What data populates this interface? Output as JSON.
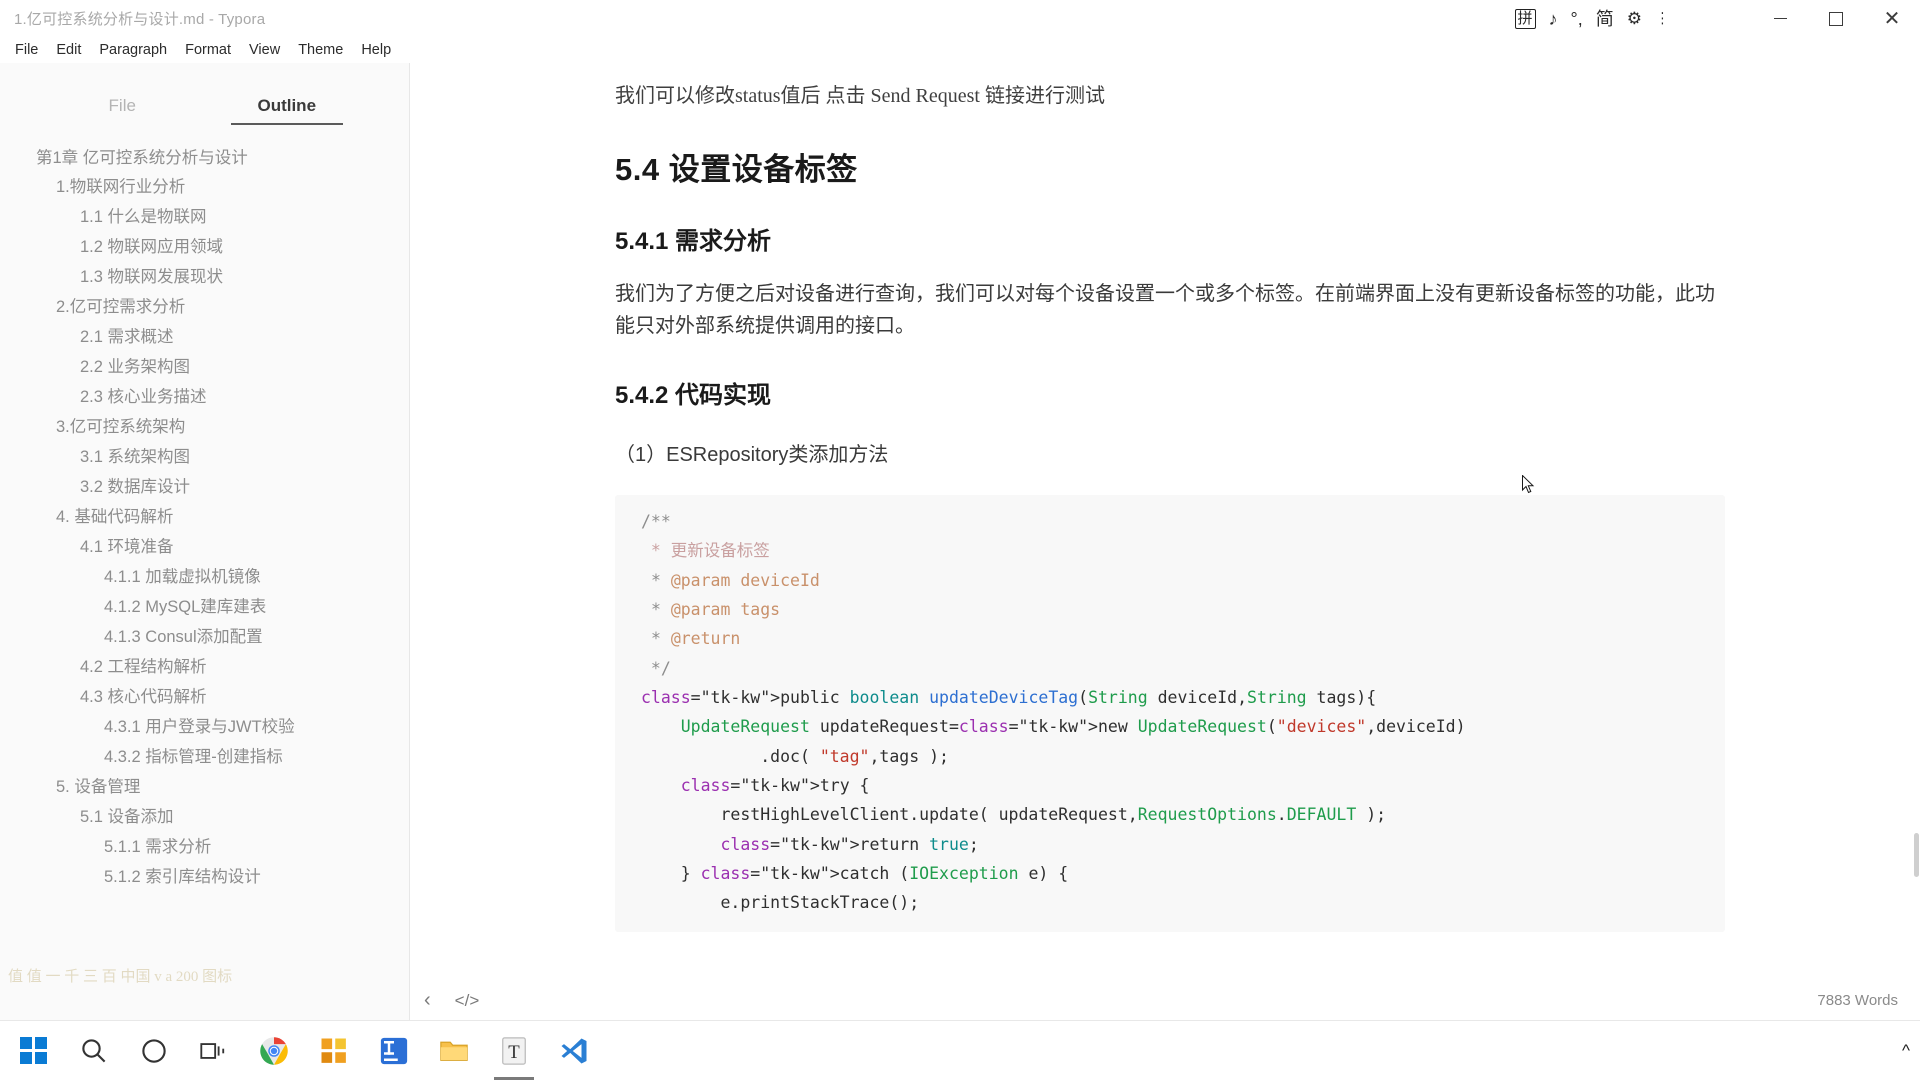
{
  "window": {
    "title": "1.亿可控系统分析与设计.md - Typora",
    "minimize_label": "Minimize",
    "maximize_label": "Maximize",
    "close_label": "Close"
  },
  "tray": {
    "ime_label": "拼",
    "music_icon": "♪",
    "keyboard_icon": "°,",
    "mode_label": "简",
    "gear_icon": "⚙",
    "more_icon": "⋮"
  },
  "menubar": {
    "items": [
      {
        "label": "File",
        "name": "menu-file"
      },
      {
        "label": "Edit",
        "name": "menu-edit"
      },
      {
        "label": "Paragraph",
        "name": "menu-paragraph"
      },
      {
        "label": "Format",
        "name": "menu-format"
      },
      {
        "label": "View",
        "name": "menu-view"
      },
      {
        "label": "Theme",
        "name": "menu-theme"
      },
      {
        "label": "Help",
        "name": "menu-help"
      }
    ]
  },
  "sidebar": {
    "tabs": [
      {
        "label": "File",
        "active": false
      },
      {
        "label": "Outline",
        "active": true
      }
    ],
    "outline": [
      {
        "label": "第1章 亿可控系统分析与设计",
        "level": 1
      },
      {
        "label": "1.物联网行业分析",
        "level": 2
      },
      {
        "label": "1.1 什么是物联网",
        "level": 3
      },
      {
        "label": "1.2 物联网应用领域",
        "level": 3
      },
      {
        "label": "1.3 物联网发展现状",
        "level": 3
      },
      {
        "label": "2.亿可控需求分析",
        "level": 2
      },
      {
        "label": "2.1 需求概述",
        "level": 3
      },
      {
        "label": "2.2 业务架构图",
        "level": 3
      },
      {
        "label": "2.3 核心业务描述",
        "level": 3
      },
      {
        "label": "3.亿可控系统架构",
        "level": 2
      },
      {
        "label": "3.1 系统架构图",
        "level": 3
      },
      {
        "label": "3.2 数据库设计",
        "level": 3
      },
      {
        "label": "4. 基础代码解析",
        "level": 2
      },
      {
        "label": "4.1 环境准备",
        "level": 3
      },
      {
        "label": "4.1.1 加载虚拟机镜像",
        "level": 4
      },
      {
        "label": "4.1.2 MySQL建库建表",
        "level": 4
      },
      {
        "label": "4.1.3 Consul添加配置",
        "level": 4
      },
      {
        "label": "4.2 工程结构解析",
        "level": 3
      },
      {
        "label": "4.3 核心代码解析",
        "level": 3
      },
      {
        "label": "4.3.1 用户登录与JWT校验",
        "level": 4
      },
      {
        "label": "4.3.2 指标管理-创建指标",
        "level": 4
      },
      {
        "label": "5. 设备管理",
        "level": 2
      },
      {
        "label": "5.1 设备添加",
        "level": 3
      },
      {
        "label": "5.1.1 需求分析",
        "level": 4
      },
      {
        "label": "5.1.2 索引库结构设计",
        "level": 4
      }
    ],
    "watermark": "值 值 一 千 三 百 中国 v a 200 图标"
  },
  "document": {
    "intro_note": "我们可以修改status值后 点击 Send Request 链接进行测试",
    "h1": "5.4 设置设备标签",
    "h2_1": "5.4.1 需求分析",
    "body_1": "我们为了方便之后对设备进行查询，我们可以对每个设备设置一个或多个标签。在前端界面上没有更新设备标签的功能，此功能只对外部系统提供调用的接口。",
    "h2_2": "5.4.2 代码实现",
    "sub_1": "（1）ESRepository类添加方法",
    "code_lines": [
      "/**",
      " * 更新设备标签",
      " * @param deviceId",
      " * @param tags",
      " * @return",
      " */",
      "public boolean updateDeviceTag(String deviceId,String tags){",
      "    UpdateRequest updateRequest=new UpdateRequest(\"devices\",deviceId)",
      "            .doc( \"tag\",tags );",
      "    try {",
      "        restHighLevelClient.update( updateRequest,RequestOptions.DEFAULT );",
      "        return true;",
      "    } catch (IOException e) {",
      "        e.printStackTrace();"
    ]
  },
  "statusbar": {
    "back_icon": "‹",
    "source_icon": "</>",
    "word_count": "7883 Words"
  },
  "taskbar": {
    "items": [
      {
        "name": "start-button",
        "icon": "windows-logo"
      },
      {
        "name": "search-button",
        "icon": "search-icon"
      },
      {
        "name": "cortana-button",
        "icon": "circle-icon"
      },
      {
        "name": "task-view-button",
        "icon": "task-view-icon"
      },
      {
        "name": "chrome-button",
        "icon": "chrome-icon"
      },
      {
        "name": "app-orange-button",
        "icon": "grid-orange-icon"
      },
      {
        "name": "idea-button",
        "icon": "intellij-icon"
      },
      {
        "name": "explorer-button",
        "icon": "folder-icon"
      },
      {
        "name": "typora-button",
        "icon": "typora-icon"
      },
      {
        "name": "vscode-button",
        "icon": "vscode-icon"
      }
    ],
    "caret_icon": "^"
  },
  "colors": {
    "accent": "#5a5a5a",
    "keyword": "#9b30b0",
    "type": "#1f9c4c",
    "function": "#2d6fd1",
    "string": "#c0392b",
    "comment": "#8d8d8d",
    "javadoc": "#c9916b"
  }
}
